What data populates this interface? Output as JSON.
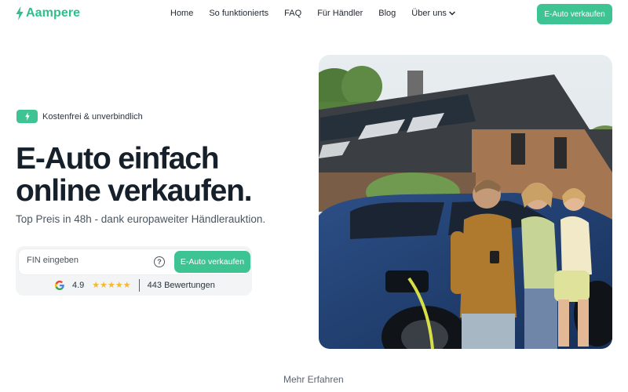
{
  "brand": {
    "name": "Aampere",
    "accent": "#3ec493",
    "icon": "lightning-bolt-icon"
  },
  "nav": {
    "links": [
      "Home",
      "So funktionierts",
      "FAQ",
      "Für Händler",
      "Blog",
      "Über uns"
    ],
    "dropdown_icon": "chevron-down-icon",
    "cta_label": "E-Auto verkaufen"
  },
  "hero": {
    "badge_text": "Kostenfrei & unverbindlich",
    "headline_line1": "E-Auto einfach",
    "headline_line2": "online verkaufen.",
    "subline": "Top Preis in 48h - dank europaweiter Händlerauktion.",
    "search": {
      "placeholder": "FIN eingeben",
      "value": "",
      "help_icon": "question-circle-icon",
      "help_symbol": "?",
      "button_label": "E-Auto verkaufen"
    },
    "rating": {
      "provider_icon": "google-g-icon",
      "value": "4.9",
      "stars": 4.9,
      "star_count": 5,
      "reviews_label": "443 Bewertungen"
    },
    "image": {
      "subject": "family-charging-electric-car-photo"
    }
  },
  "footer_link": "Mehr Erfahren"
}
